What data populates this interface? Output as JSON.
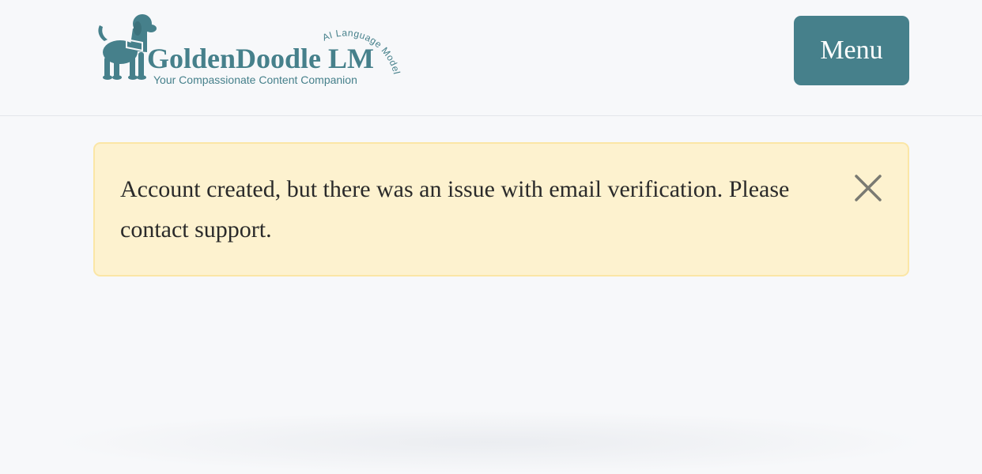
{
  "header": {
    "logo": {
      "brand_name": "GoldenDoodle LM",
      "tagline": "Your Compassionate Content Companion",
      "arc_text": "AI Language Model",
      "icon": "dog-icon",
      "color": "#46808b"
    },
    "menu_label": "Menu"
  },
  "alert": {
    "message": "Account created, but there was an issue with email verification. Please contact support.",
    "close_icon": "close-icon",
    "background": "#fdf2cf",
    "border": "#fbe6a6"
  },
  "colors": {
    "accent": "#46808b",
    "page_background": "#f7f8fa"
  }
}
